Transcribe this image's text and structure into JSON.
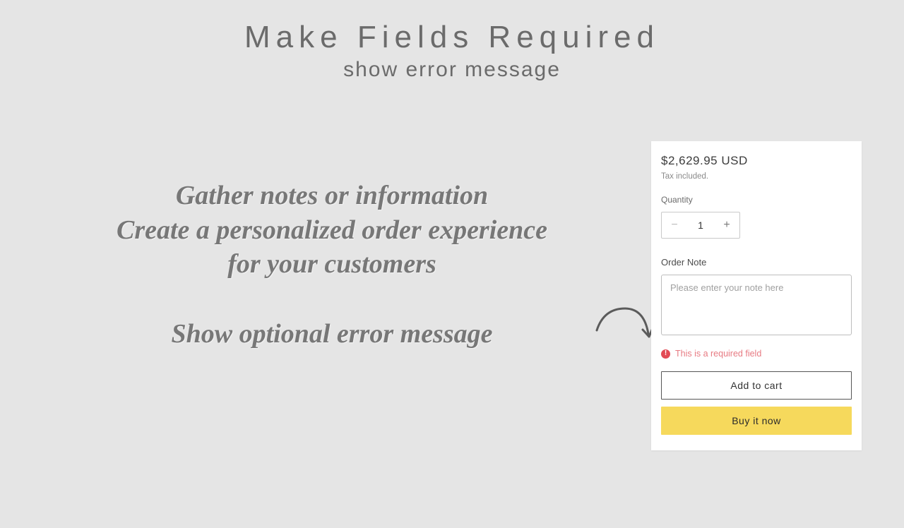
{
  "header": {
    "title": "Make Fields Required",
    "subtitle": "show error message"
  },
  "marketing": {
    "line1": "Gather notes or information",
    "line2": "Create a personalized order experience",
    "line3": "for your customers",
    "line4": "Show optional error message"
  },
  "product_card": {
    "price": "$2,629.95 USD",
    "tax_note": "Tax included.",
    "quantity_label": "Quantity",
    "quantity_value": "1",
    "order_note_label": "Order Note",
    "order_note_placeholder": "Please enter your note here",
    "error_message": "This is a required field",
    "add_to_cart_label": "Add to cart",
    "buy_now_label": "Buy it now"
  }
}
